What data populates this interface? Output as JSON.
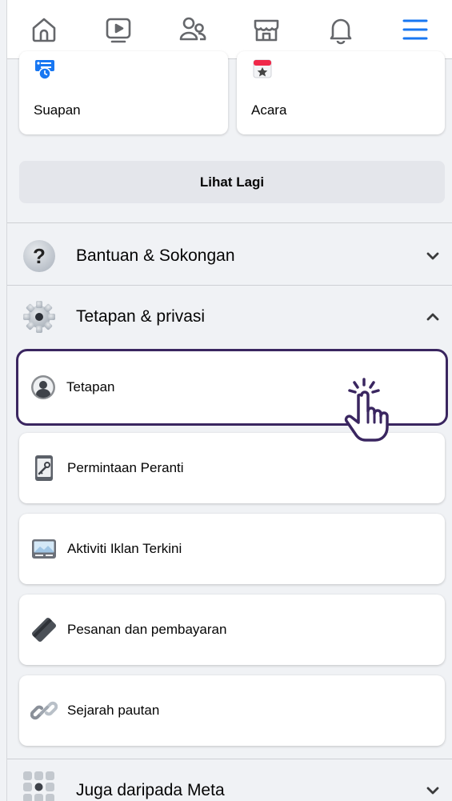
{
  "topnav": {
    "items": [
      {
        "icon": "home-icon",
        "active": false
      },
      {
        "icon": "video-icon",
        "active": false
      },
      {
        "icon": "friends-icon",
        "active": false
      },
      {
        "icon": "marketplace-icon",
        "active": false
      },
      {
        "icon": "bell-icon",
        "active": false
      },
      {
        "icon": "menu-icon",
        "active": true
      }
    ],
    "accent": "#1877f2"
  },
  "shortcuts": [
    {
      "label": "Suapan",
      "icon": "feeds-icon"
    },
    {
      "label": "Acara",
      "icon": "events-icon"
    }
  ],
  "see_more_label": "Lihat Lagi",
  "sections": {
    "help": {
      "label": "Bantuan & Sokongan",
      "icon": "help-icon",
      "expanded": false
    },
    "settings": {
      "label": "Tetapan & privasi",
      "icon": "gear-icon",
      "expanded": true,
      "items": [
        {
          "label": "Tetapan",
          "icon": "profile-icon",
          "selected": true
        },
        {
          "label": "Permintaan Peranti",
          "icon": "device-icon",
          "selected": false
        },
        {
          "label": "Aktiviti Iklan Terkini",
          "icon": "ad-icon",
          "selected": false
        },
        {
          "label": "Pesanan dan pembayaran",
          "icon": "tag-icon",
          "selected": false
        },
        {
          "label": "Sejarah pautan",
          "icon": "link-icon",
          "selected": false
        }
      ]
    },
    "meta": {
      "label": "Juga daripada Meta",
      "icon": "apps-grid-icon",
      "expanded": false
    }
  },
  "highlight_color": "#3a2660"
}
